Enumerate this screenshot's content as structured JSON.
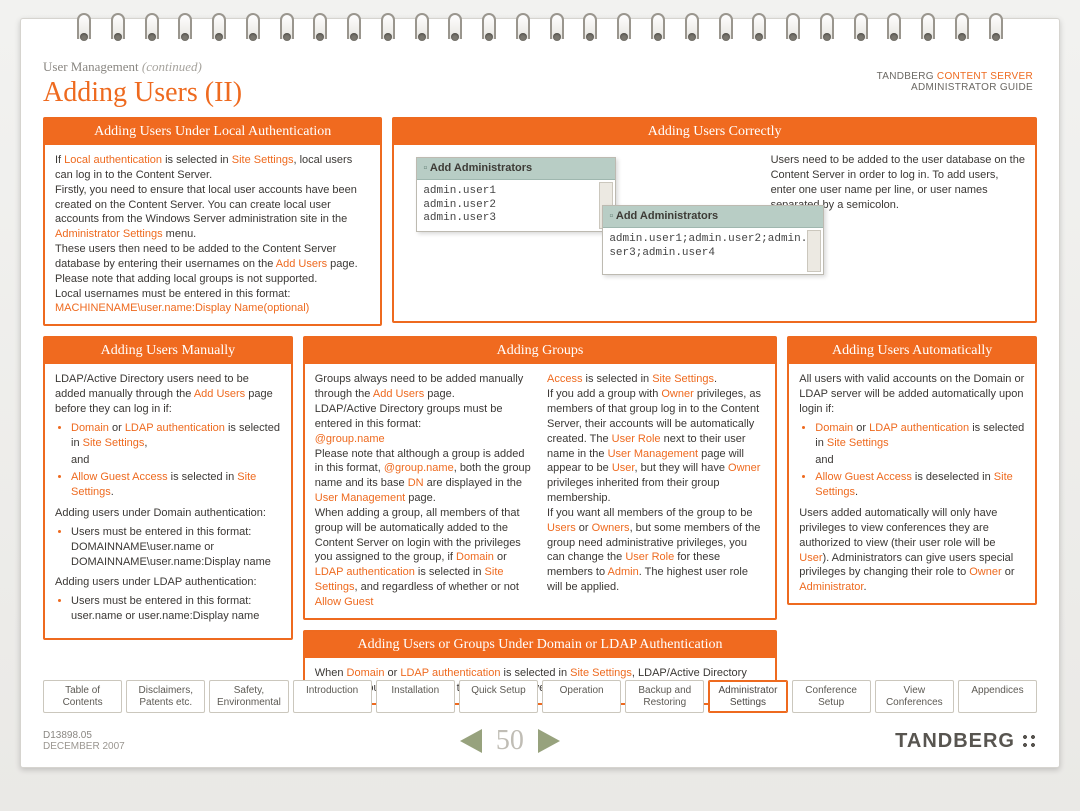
{
  "breadcrumb": {
    "section": "User Management",
    "cont": "(continued)"
  },
  "title": "Adding Users (II)",
  "brand": {
    "t": "TANDBERG",
    "cs": "CONTENT SERVER",
    "g": "ADMINISTRATOR GUIDE"
  },
  "panels": {
    "local": {
      "hdr": "Adding Users Under Local Authentication",
      "p1a": "If ",
      "p1b": "Local authentication",
      "p1c": " is selected in ",
      "p1d": "Site Settings",
      "p1e": ", local users can log in to the Content Server.",
      "p2a": "Firstly, you need to ensure that local user accounts have been created on the Content Server. You can create local user accounts from the Windows Server administration site in the ",
      "p2b": "Administrator Settings",
      "p2c": " menu.",
      "p3a": "These users then need to be added to the Content Server database by entering their usernames on the ",
      "p3b": "Add Users",
      "p3c": " page. Please note that adding local groups is not supported.",
      "p4": "Local usernames must be entered in this format:",
      "p5": "MACHINENAME\\user.name:Display Name(optional)"
    },
    "correct": {
      "hdr": "Adding Users Correctly",
      "intro": "Users need to be added to the user database on the Content Server in order to log in. To add users, enter one user name per line, or user names separated by a semicolon.",
      "shot1hdr": "Add Administrators",
      "shot1body": "admin.user1\nadmin.user2\nadmin.user3",
      "shot2hdr": "Add Administrators",
      "shot2body": "admin.user1;admin.user2;admin.user3;admin.user4"
    },
    "manual": {
      "hdr": "Adding Users Manually",
      "p1a": "LDAP/Active Directory users need to be added manually through the ",
      "p1b": "Add Users",
      "p1c": " page before they can log in if:",
      "b1a": "Domain",
      "b1b": " or ",
      "b1c": "LDAP authentication",
      "b1d": " is selected in ",
      "b1e": "Site Settings",
      "b1f": ",",
      "and": "and",
      "b2a": "Allow Guest Access",
      "b2b": " is selected in ",
      "b2c": "Site Settings",
      "b2d": ".",
      "p2": "Adding users under Domain authentication:",
      "b3": "Users must be entered in this format: DOMAINNAME\\user.name or DOMAINNAME\\user.name:Display name",
      "p3": "Adding users under LDAP authentication:",
      "b4": "Users must be entered in this format: user.name or user.name:Display name"
    },
    "groups": {
      "hdr": "Adding Groups",
      "l_p1a": "Groups always need to be added manually through the ",
      "l_p1b": "Add Users",
      "l_p1c": " page.",
      "l_p2": "LDAP/Active Directory groups must be entered in this format:",
      "l_p3": "@group.name",
      "l_p4a": "Please note that although a group is added in this format, ",
      "l_p4b": "@group.name",
      "l_p4c": ", both the group name and its base ",
      "l_p4d": "DN",
      "l_p4e": " are displayed in the ",
      "l_p4f": "User Management",
      "l_p4g": " page.",
      "l_p5a": "When adding a group, all members of that group will be automatically added to the Content Server on login with the privileges you assigned to the group, if ",
      "l_p5b": "Domain",
      "l_p5c": " or ",
      "l_p5d": "LDAP authentication",
      "l_p5e": " is selected in ",
      "l_p5f": "Site Settings",
      "l_p5g": ", and regardless of whether or not ",
      "l_p5h": "Allow Guest",
      "r_p1a": "Access",
      "r_p1b": " is selected in ",
      "r_p1c": "Site Settings",
      "r_p1d": ".",
      "r_p2a": "If you add a group with ",
      "r_p2b": "Owner",
      "r_p2c": " privileges, as members of that group log in to the Content Server, their accounts will be automatically created. The ",
      "r_p2d": "User Role",
      "r_p2e": " next to their user name in the ",
      "r_p2f": "User Management",
      "r_p2g": " page will appear to be ",
      "r_p2h": "User",
      "r_p2i": ", but they will have ",
      "r_p2j": "Owner",
      "r_p2k": " privileges inherited from their group membership.",
      "r_p3a": "If you want all members of the group to be ",
      "r_p3b": "Users",
      "r_p3c": " or ",
      "r_p3d": "Owners",
      "r_p3e": ", but some members of the group need administrative privileges, you can change the ",
      "r_p3f": "User Role",
      "r_p3g": " for these members to ",
      "r_p3h": "Admin",
      "r_p3i": ". The highest user role will be applied."
    },
    "auto": {
      "hdr": "Adding Users Automatically",
      "p1": "All users with valid accounts on the Domain or LDAP server will be added automatically upon login if:",
      "b1a": "Domain",
      "b1b": " or ",
      "b1c": "LDAP authentication",
      "b1d": " is selected in ",
      "b1e": "Site Settings",
      "and": "and",
      "b2a": "Allow Guest Access",
      "b2b": " is deselected in ",
      "b2c": "Site Settings",
      "b2d": ".",
      "p2a": "Users added automatically will only have privileges to view conferences they are authorized to view (their user role will be ",
      "p2b": "User",
      "p2c": "). Administrators can give users special privileges by changing their role to ",
      "p2d": "Owner",
      "p2e": " or ",
      "p2f": "Administrator",
      "p2g": "."
    },
    "domainldap": {
      "hdr": "Adding Users or Groups Under Domain or LDAP Authentication",
      "p1a": "When ",
      "p1b": "Domain",
      "p1c": " or ",
      "p1d": "LDAP authentication",
      "p1e": " is selected in ",
      "p1f": "Site Settings",
      "p1g": ", LDAP/Active Directory users or groups can log in to the Content Server."
    }
  },
  "tabs": [
    {
      "l1": "Table of",
      "l2": "Contents"
    },
    {
      "l1": "Disclaimers,",
      "l2": "Patents etc."
    },
    {
      "l1": "Safety,",
      "l2": "Environmental"
    },
    {
      "l1": "Introduction",
      "l2": ""
    },
    {
      "l1": "Installation",
      "l2": ""
    },
    {
      "l1": "Quick Setup",
      "l2": ""
    },
    {
      "l1": "Operation",
      "l2": ""
    },
    {
      "l1": "Backup and",
      "l2": "Restoring"
    },
    {
      "l1": "Administrator",
      "l2": "Settings"
    },
    {
      "l1": "Conference",
      "l2": "Setup"
    },
    {
      "l1": "View",
      "l2": "Conferences"
    },
    {
      "l1": "Appendices",
      "l2": ""
    }
  ],
  "activeTab": 8,
  "footer": {
    "doc": "D13898.05",
    "date": "DECEMBER 2007",
    "page": "50",
    "logo": "TANDBERG"
  }
}
